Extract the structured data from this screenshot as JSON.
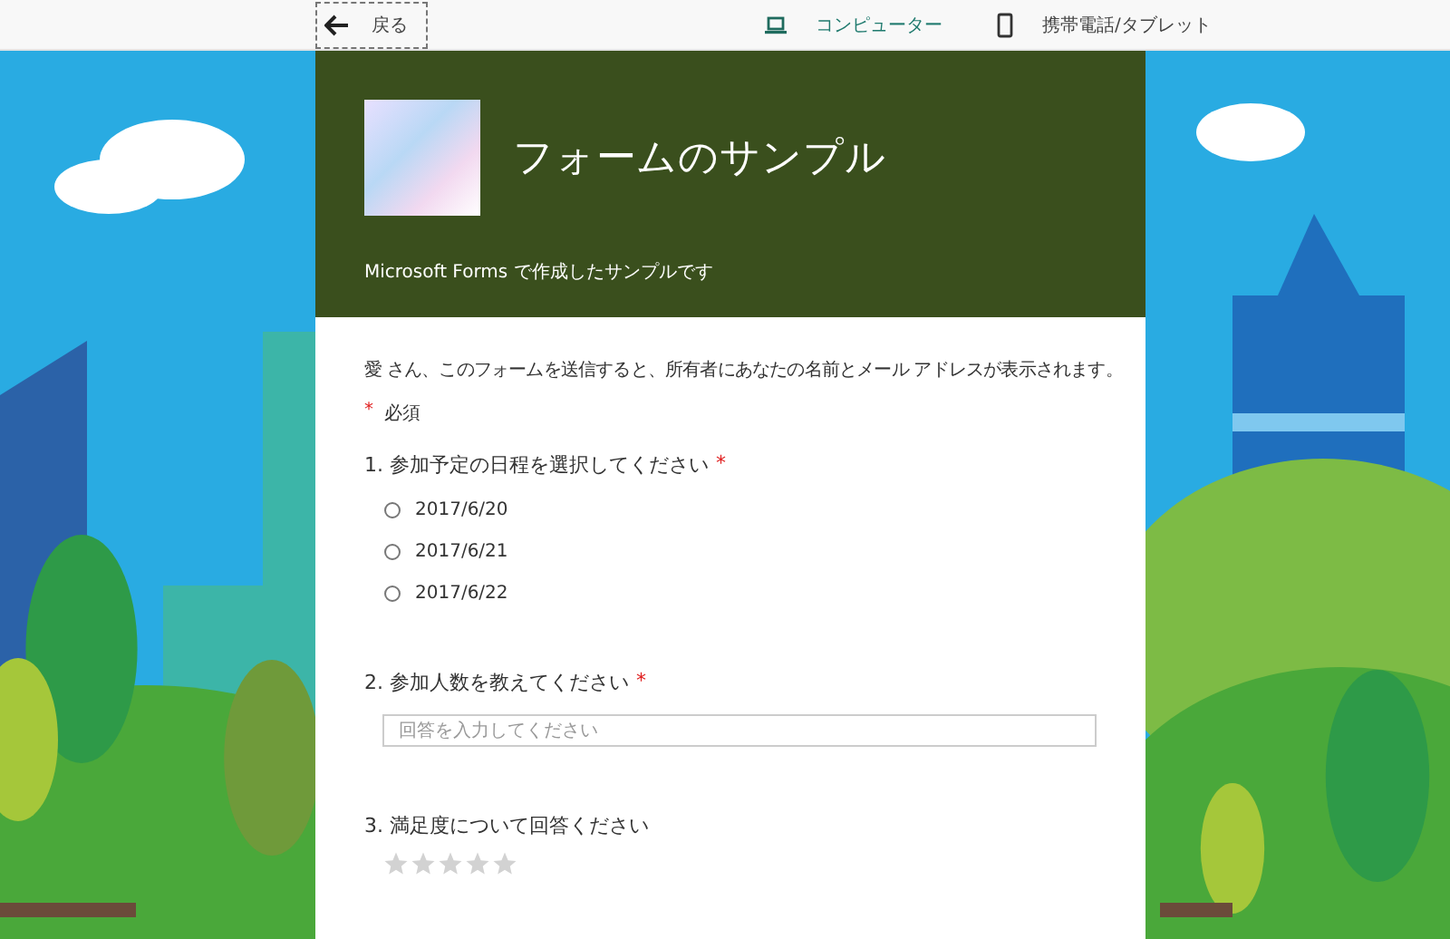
{
  "topbar": {
    "back": "戻る",
    "views": [
      {
        "kind": "computer",
        "label": "コンピューター",
        "selected": true
      },
      {
        "kind": "phone",
        "label": "携帯電話/タブレット",
        "selected": false
      }
    ]
  },
  "form": {
    "title": "フォームのサンプル",
    "subtitle": "Microsoft Forms で作成したサンプルです",
    "notice": "愛 さん、このフォームを送信すると、所有者にあなたの名前とメール アドレスが表示されます。",
    "required_mark": "*",
    "required_label": "必須",
    "questions": [
      {
        "kind": "choice",
        "title": "1. 参加予定の日程を選択してください",
        "required": true,
        "options": [
          {
            "label": "2017/6/20",
            "selected": false
          },
          {
            "label": "2017/6/21",
            "selected": false
          },
          {
            "label": "2017/6/22",
            "selected": false
          }
        ]
      },
      {
        "kind": "text",
        "title": "2. 参加人数を教えてください",
        "required": true,
        "placeholder": "回答を入力してください"
      },
      {
        "kind": "rating",
        "title": "3. 満足度について回答ください",
        "required": false,
        "stars": 0
      }
    ]
  }
}
